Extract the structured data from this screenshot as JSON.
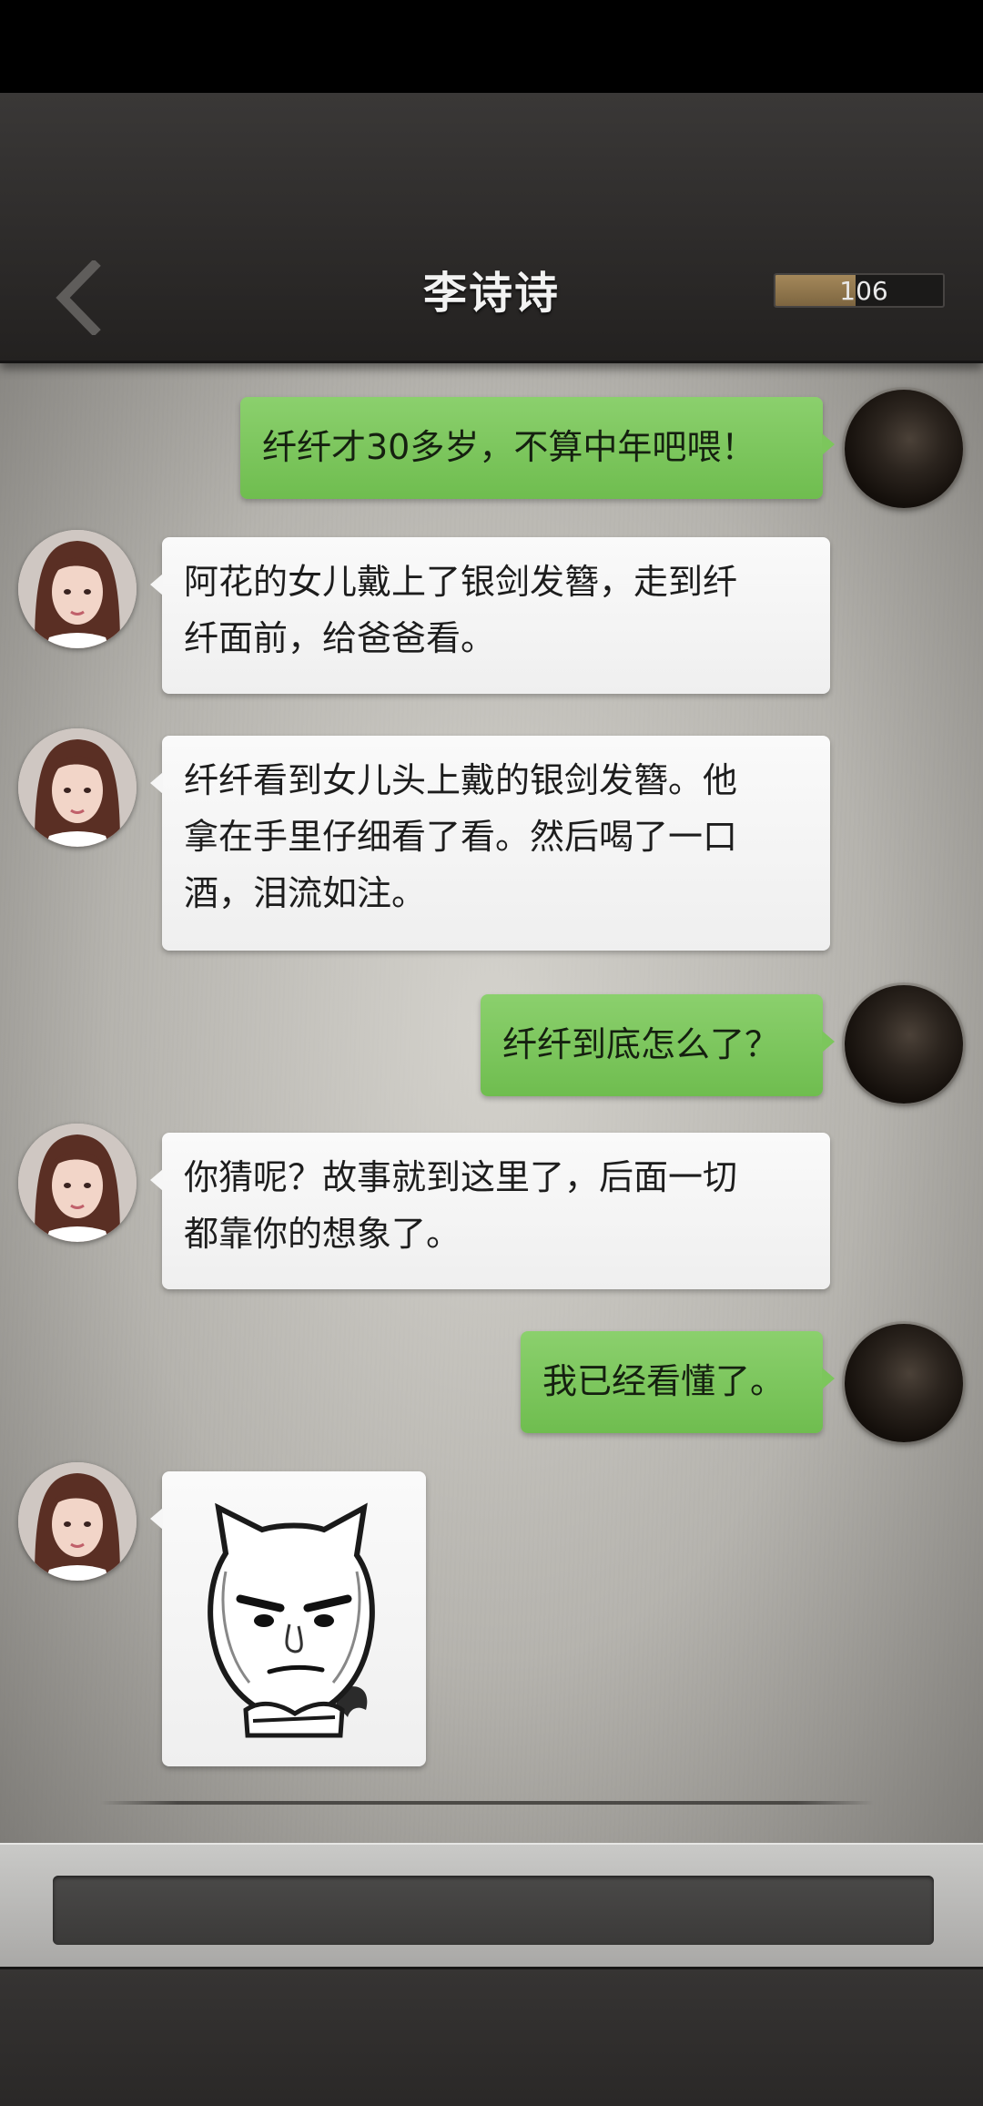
{
  "header": {
    "title": "李诗诗",
    "progress_value": "106",
    "progress_fraction": 0.48
  },
  "icons": {
    "back": "chevron-left-icon",
    "self_avatar": "avatar-self",
    "contact_avatar": "avatar-contact",
    "sticker": "cat-face-sticker"
  },
  "colors": {
    "sent_bubble": "#7cc65c",
    "received_bubble": "#f6f6f6",
    "progress_fill": "#9a7f52"
  },
  "messages": [
    {
      "from": "self",
      "lines": [
        "纤纤才30多岁，不算中年吧喂！"
      ]
    },
    {
      "from": "contact",
      "lines": [
        "阿花的女儿戴上了银剑发簪，走到纤",
        "纤面前，给爸爸看。"
      ]
    },
    {
      "from": "contact",
      "lines": [
        "纤纤看到女儿头上戴的银剑发簪。他",
        "拿在手里仔细看了看。然后喝了一口",
        "酒，泪流如注。"
      ]
    },
    {
      "from": "self",
      "lines": [
        "纤纤到底怎么了？"
      ]
    },
    {
      "from": "contact",
      "lines": [
        "你猜呢？故事就到这里了，后面一切",
        "都靠你的想象了。"
      ]
    },
    {
      "from": "self",
      "lines": [
        "我已经看懂了。"
      ]
    },
    {
      "from": "contact",
      "type": "sticker"
    }
  ],
  "input": {
    "value": "",
    "placeholder": ""
  }
}
